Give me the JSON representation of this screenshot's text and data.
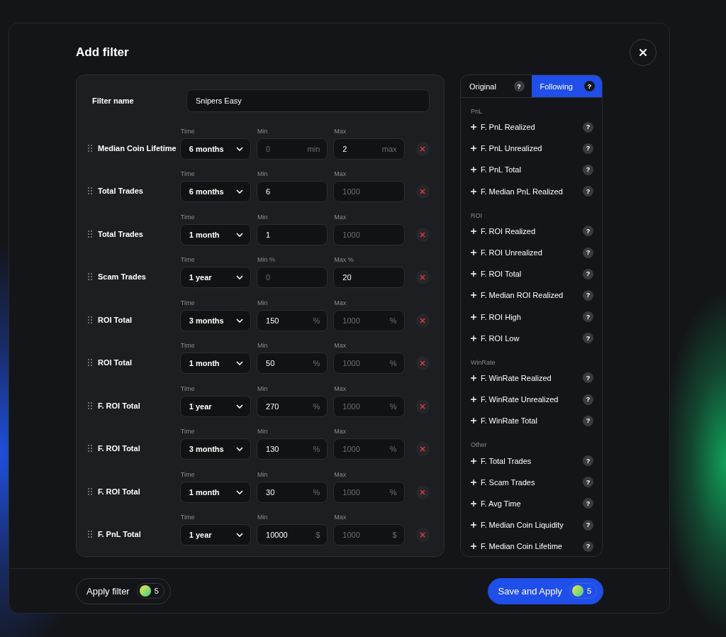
{
  "dialog": {
    "title": "Add filter",
    "filter_name": {
      "label": "Filter name",
      "value": "Snipers Easy"
    },
    "rows": [
      {
        "label": "Median Coin Lifetime",
        "time_label": "Time",
        "time": "6 months",
        "min_label": "Min",
        "min": {
          "placeholder": "0",
          "unit": "min"
        },
        "max_label": "Max",
        "max": {
          "value": "2",
          "unit": "max"
        }
      },
      {
        "label": "Total Trades",
        "time_label": "Time",
        "time": "6 months",
        "min_label": "Min",
        "min": {
          "value": "6"
        },
        "max_label": "Max",
        "max": {
          "placeholder": "1000"
        }
      },
      {
        "label": "Total Trades",
        "time_label": "Time",
        "time": "1 month",
        "min_label": "Min",
        "min": {
          "value": "1"
        },
        "max_label": "Max",
        "max": {
          "placeholder": "1000"
        }
      },
      {
        "label": "Scam Trades",
        "time_label": "Time",
        "time": "1 year",
        "min_label": "Min %",
        "min": {
          "placeholder": "0"
        },
        "max_label": "Max %",
        "max": {
          "value": "20"
        }
      },
      {
        "label": "ROI Total",
        "time_label": "Time",
        "time": "3 months",
        "min_label": "Min",
        "min": {
          "value": "150",
          "unit": "%"
        },
        "max_label": "Max",
        "max": {
          "placeholder": "1000",
          "unit": "%"
        }
      },
      {
        "label": "ROI Total",
        "time_label": "Time",
        "time": "1 month",
        "min_label": "Min",
        "min": {
          "value": "50",
          "unit": "%"
        },
        "max_label": "Max",
        "max": {
          "placeholder": "1000",
          "unit": "%"
        }
      },
      {
        "label": "F. ROI Total",
        "time_label": "Time",
        "time": "1 year",
        "min_label": "Min",
        "min": {
          "value": "270",
          "unit": "%"
        },
        "max_label": "Max",
        "max": {
          "placeholder": "1000",
          "unit": "%"
        }
      },
      {
        "label": "F. ROI Total",
        "time_label": "Time",
        "time": "3 months",
        "min_label": "Min",
        "min": {
          "value": "130",
          "unit": "%"
        },
        "max_label": "Max",
        "max": {
          "placeholder": "1000",
          "unit": "%"
        }
      },
      {
        "label": "F. ROI Total",
        "time_label": "Time",
        "time": "1 month",
        "min_label": "Min",
        "min": {
          "value": "30",
          "unit": "%"
        },
        "max_label": "Max",
        "max": {
          "placeholder": "1000",
          "unit": "%"
        }
      },
      {
        "label": "F. PnL Total",
        "time_label": "Time",
        "time": "1 year",
        "min_label": "Min",
        "min": {
          "value": "10000",
          "unit": "$"
        },
        "max_label": "Max",
        "max": {
          "placeholder": "1000",
          "unit": "$"
        }
      }
    ],
    "tabs": [
      {
        "label": "Original",
        "help": "?",
        "selected": false
      },
      {
        "label": "Following",
        "help": "?",
        "selected": true
      }
    ],
    "groups": [
      {
        "title": "PnL",
        "items": [
          "F. PnL Realized",
          "F. PnL Unrealized",
          "F. PnL Total",
          "F. Median PnL Realized"
        ]
      },
      {
        "title": "ROI",
        "items": [
          "F. ROI Realized",
          "F. ROI Unrealized",
          "F. ROI Total",
          "F. Median ROI Realized",
          "F. ROI High",
          "F. ROI Low"
        ]
      },
      {
        "title": "WinRate",
        "items": [
          "F. WinRate Realized",
          "F. WinRate Unrealized",
          "F. WinRate Total"
        ]
      },
      {
        "title": "Other",
        "items": [
          "F. Total Trades",
          "F. Scam Trades",
          "F. Avg Time",
          "F. Median Coin Liquidity",
          "F. Median Coin Lifetime"
        ]
      }
    ],
    "item_help": "?",
    "buttons": [
      {
        "label": "Apply filter",
        "count": "5",
        "kind": "secondary"
      },
      {
        "label": "Save and Apply",
        "count": "5",
        "kind": "primary"
      }
    ]
  }
}
